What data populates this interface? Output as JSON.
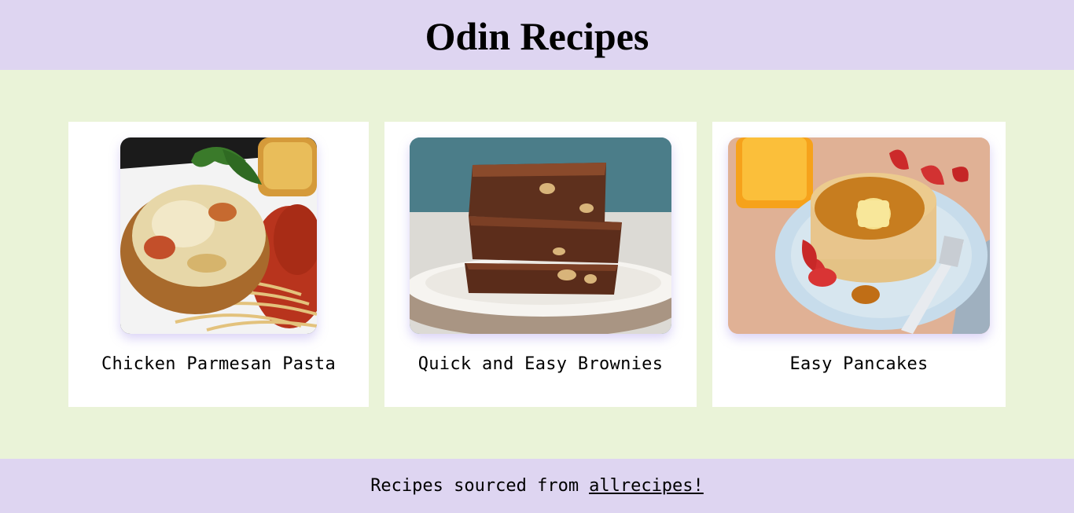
{
  "header": {
    "title": "Odin Recipes"
  },
  "recipes": [
    {
      "title": "Chicken Parmesan Pasta",
      "image": "chicken-parmesan-pasta-photo"
    },
    {
      "title": "Quick and Easy Brownies",
      "image": "brownies-photo"
    },
    {
      "title": "Easy Pancakes",
      "image": "pancakes-photo"
    }
  ],
  "footer": {
    "text": "Recipes sourced from",
    "link_label": "allrecipes!"
  },
  "colors": {
    "header_bg": "#ded5f1",
    "page_bg": "#eaf3d8",
    "card_bg": "#ffffff"
  }
}
